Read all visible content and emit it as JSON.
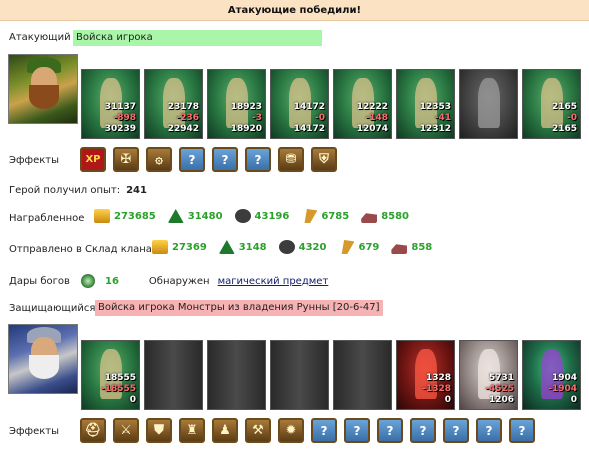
{
  "banner": "Атакующие победили!",
  "attacker": {
    "label": "Атакующий",
    "side_name": "Войска игрока",
    "units": [
      {
        "qty": "31137",
        "loss": "-898",
        "remain": "30239",
        "style": "green"
      },
      {
        "qty": "23178",
        "loss": "-236",
        "remain": "22942",
        "style": "green"
      },
      {
        "qty": "18923",
        "loss": "-3",
        "remain": "18920",
        "style": "green"
      },
      {
        "qty": "14172",
        "loss": "-0",
        "remain": "14172",
        "style": "green"
      },
      {
        "qty": "12222",
        "loss": "-148",
        "remain": "12074",
        "style": "green"
      },
      {
        "qty": "12353",
        "loss": "-41",
        "remain": "12312",
        "style": "green"
      },
      {
        "qty": "",
        "loss": "",
        "remain": "",
        "style": "grey"
      },
      {
        "qty": "2165",
        "loss": "-0",
        "remain": "2165",
        "style": "green"
      }
    ],
    "effects_label": "Эффекты",
    "effects": [
      {
        "icon": "xp-icon",
        "glyph": "XP",
        "kind": "xp"
      },
      {
        "icon": "shield-crest-icon",
        "glyph": "✠",
        "kind": "ic"
      },
      {
        "icon": "spiral-icon",
        "glyph": "۞",
        "kind": "ic"
      },
      {
        "icon": "unknown-effect-icon",
        "glyph": "?",
        "kind": "q"
      },
      {
        "icon": "unknown-effect-icon",
        "glyph": "?",
        "kind": "q"
      },
      {
        "icon": "unknown-effect-icon",
        "glyph": "?",
        "kind": "q"
      },
      {
        "icon": "coins-icon",
        "glyph": "⛃",
        "kind": "ic"
      },
      {
        "icon": "armor-icon",
        "glyph": "⛨",
        "kind": "ic"
      }
    ]
  },
  "experience": {
    "label": "Герой получил опыт:",
    "value": "241"
  },
  "looted": {
    "label": "Награбленное",
    "resources": [
      {
        "icon": "gold-icon",
        "kind": "gold",
        "value": "273685"
      },
      {
        "icon": "wood-icon",
        "kind": "wood",
        "value": "31480"
      },
      {
        "icon": "ore-icon",
        "kind": "ore",
        "value": "43196"
      },
      {
        "icon": "grain-icon",
        "kind": "grain",
        "value": "6785"
      },
      {
        "icon": "stone-icon",
        "kind": "stone",
        "value": "8580"
      }
    ]
  },
  "clan_storage": {
    "label": "Отправлено в Склад клана",
    "resources": [
      {
        "icon": "gold-icon",
        "kind": "gold",
        "value": "27369"
      },
      {
        "icon": "wood-icon",
        "kind": "wood",
        "value": "3148"
      },
      {
        "icon": "ore-icon",
        "kind": "ore",
        "value": "4320"
      },
      {
        "icon": "grain-icon",
        "kind": "grain",
        "value": "679"
      },
      {
        "icon": "stone-icon",
        "kind": "stone",
        "value": "858"
      }
    ]
  },
  "gifts": {
    "label": "Дары богов",
    "value": "16",
    "found_label": "Обнаружен",
    "found_link": "магический предмет"
  },
  "defender": {
    "label": "Защищающийся",
    "side_name": "Войска игрока Монстры из владения Рунны [20-6-47]",
    "units": [
      {
        "qty": "18555",
        "loss": "-18555",
        "remain": "0",
        "style": "green"
      },
      {
        "qty": "",
        "loss": "",
        "remain": "",
        "style": "empty"
      },
      {
        "qty": "",
        "loss": "",
        "remain": "",
        "style": "empty"
      },
      {
        "qty": "",
        "loss": "",
        "remain": "",
        "style": "empty"
      },
      {
        "qty": "",
        "loss": "",
        "remain": "",
        "style": "empty"
      },
      {
        "qty": "1328",
        "loss": "-1328",
        "remain": "0",
        "style": "red"
      },
      {
        "qty": "5731",
        "loss": "-4525",
        "remain": "1206",
        "style": "stone"
      },
      {
        "qty": "1904",
        "loss": "-1904",
        "remain": "0",
        "style": "violet"
      }
    ],
    "effects_label": "Эффекты",
    "effects": [
      {
        "icon": "helmet-icon",
        "glyph": "⛑",
        "kind": "ic"
      },
      {
        "icon": "crossed-swords-icon",
        "glyph": "⚔",
        "kind": "ic"
      },
      {
        "icon": "shield-icon",
        "glyph": "⛊",
        "kind": "ic"
      },
      {
        "icon": "castle-icon",
        "glyph": "♜",
        "kind": "ic"
      },
      {
        "icon": "figures-icon",
        "glyph": "♟",
        "kind": "ic"
      },
      {
        "icon": "axes-icon",
        "glyph": "⚒",
        "kind": "ic"
      },
      {
        "icon": "flame-icon",
        "glyph": "✹",
        "kind": "ic"
      },
      {
        "icon": "unknown-effect-icon",
        "glyph": "?",
        "kind": "q"
      },
      {
        "icon": "unknown-effect-icon",
        "glyph": "?",
        "kind": "q"
      },
      {
        "icon": "unknown-effect-icon",
        "glyph": "?",
        "kind": "q"
      },
      {
        "icon": "unknown-effect-icon",
        "glyph": "?",
        "kind": "q"
      },
      {
        "icon": "unknown-effect-icon",
        "glyph": "?",
        "kind": "q"
      },
      {
        "icon": "unknown-effect-icon",
        "glyph": "?",
        "kind": "q"
      },
      {
        "icon": "unknown-effect-icon",
        "glyph": "?",
        "kind": "q"
      }
    ]
  }
}
